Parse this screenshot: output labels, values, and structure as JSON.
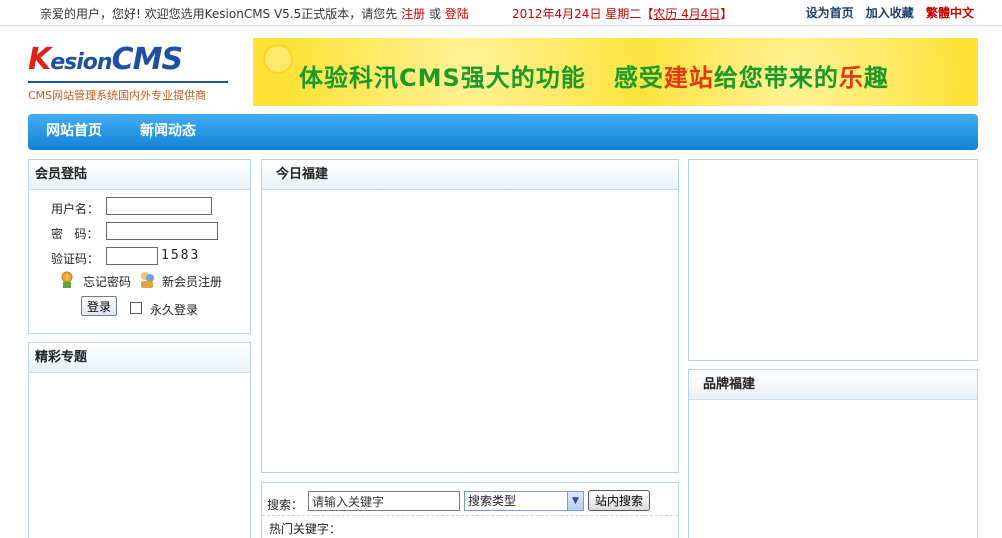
{
  "topbar": {
    "welcome_prefix": "亲爱的用户，您好! 欢迎您选用KesionCMS V5.5正式版本，请您先",
    "register": "注册",
    "or": "或",
    "login": "登陆",
    "date": "2012年4月24日  星期二【",
    "lunar": "农历 4月4日",
    "date_end": "】",
    "set_home": "设为首页",
    "add_fav": "加入收藏",
    "traditional": "繁體中文"
  },
  "header": {
    "logo_k": "K",
    "logo_esion": "esion",
    "logo_cms": "CMS",
    "tagline": "CMS网站管理系统国内外专业提供商",
    "banner_part1": "体验科汛CMS强大的功能",
    "banner_part2a": "感受",
    "banner_hl1": "建站",
    "banner_part2b": "给您带来的",
    "banner_hl2": "乐",
    "banner_part2c": "趣"
  },
  "nav": {
    "items": [
      {
        "label": "网站首页"
      },
      {
        "label": "新闻动态"
      }
    ]
  },
  "login": {
    "title": "会员登陆",
    "username_label": "用户名：",
    "password_label": "密   码：",
    "captcha_label": "验证码：",
    "captcha_code": "1583",
    "forgot": "忘记密码",
    "register": "新会员注册",
    "submit": "登录",
    "remember": "永久登录"
  },
  "topics": {
    "title": "精彩专题"
  },
  "today": {
    "title": "今日福建"
  },
  "brand": {
    "title": "品牌福建"
  },
  "search": {
    "label": "搜索：",
    "keyword_value": "请输入关键字",
    "type_selected": "搜索类型",
    "button": "站内搜索",
    "hot_label": "热门关键字："
  },
  "colors": {
    "nav_top": "#42aef0",
    "nav_bottom": "#1281d6",
    "accent_red": "#c00",
    "link_blue": "#1a3f6e"
  }
}
